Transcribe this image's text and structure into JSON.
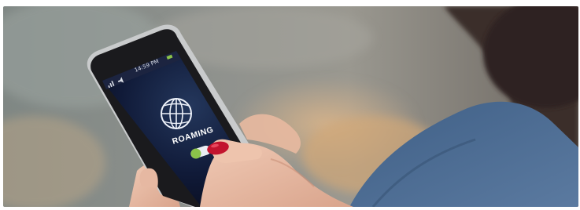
{
  "photo": {
    "phone_screen": {
      "status_time": "14:59 PM",
      "label": "ROAMING",
      "toggle_state": "on",
      "accent_color": "#8bc34a"
    },
    "icons": [
      "globe-icon",
      "signal-icon",
      "volume-icon",
      "battery-icon",
      "toggle-switch"
    ],
    "nail_color": "#c2142e",
    "screen_color": "#0b1430"
  }
}
